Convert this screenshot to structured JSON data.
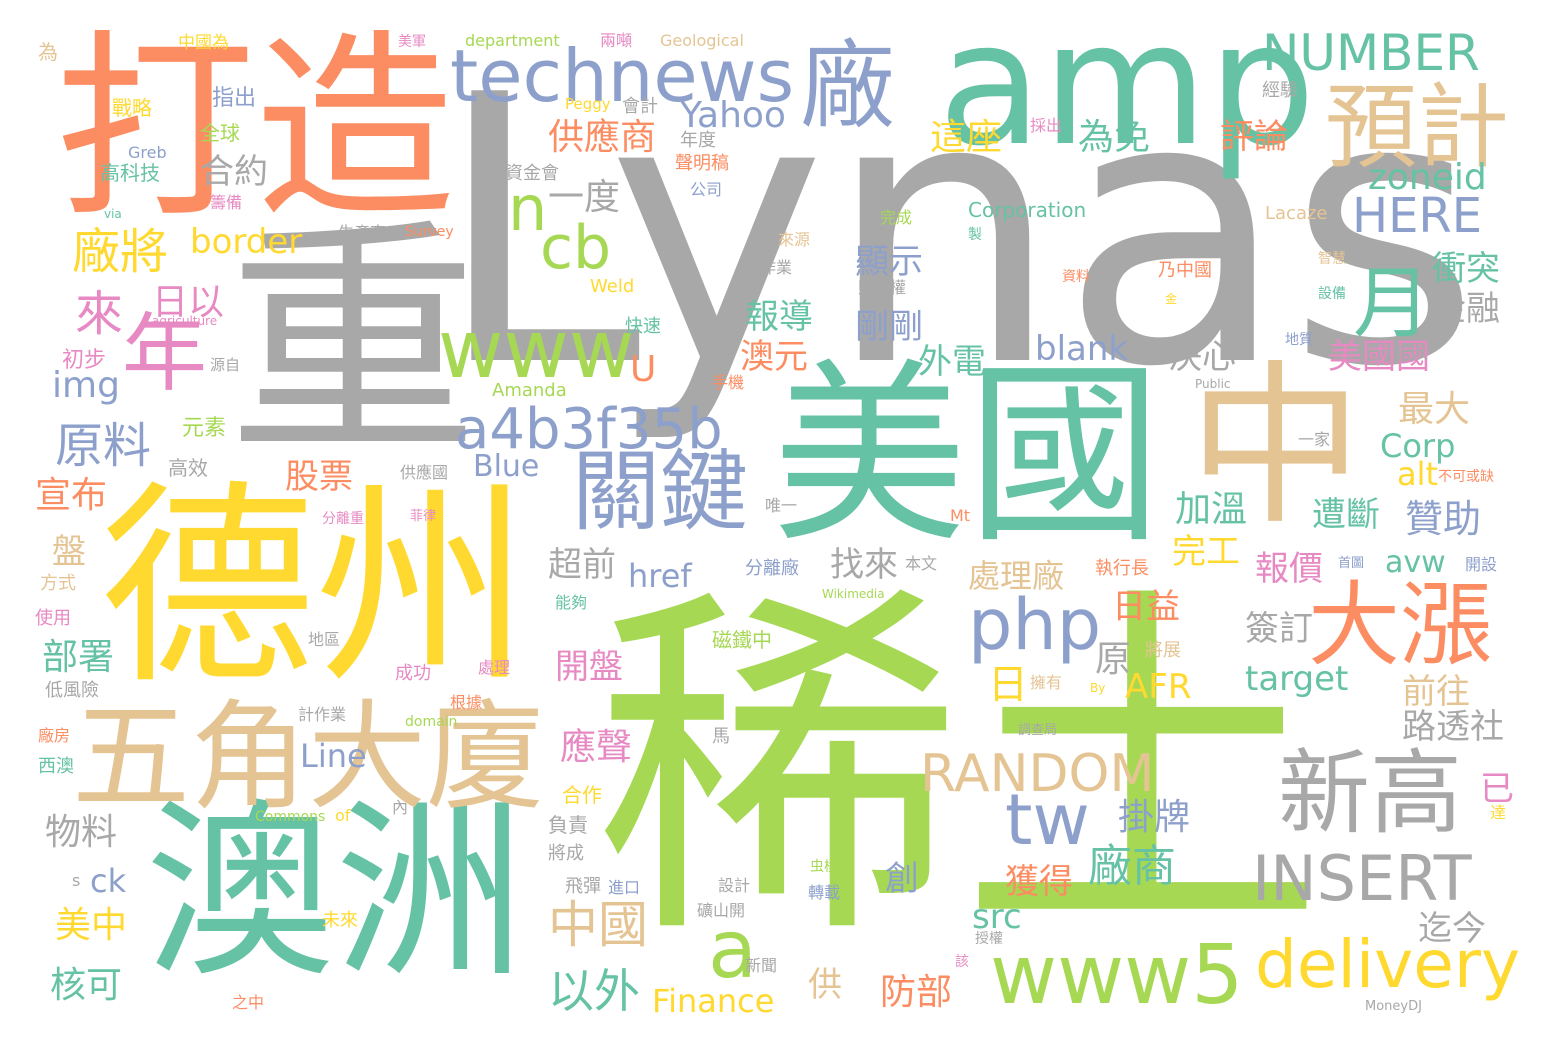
{
  "palette": {
    "gray": "#a8a8a8",
    "green": "#66c2a5",
    "orange": "#fc8d62",
    "blue": "#8da0cb",
    "pink": "#e78ac3",
    "lime": "#a6d854",
    "yellow": "#ffd92f",
    "tan": "#e5c494"
  },
  "words": [
    {
      "text": "Lynas",
      "color": "gray"
    },
    {
      "text": "稀土",
      "color": "lime"
    },
    {
      "text": "重",
      "color": "gray"
    },
    {
      "text": "美國",
      "color": "green"
    },
    {
      "text": "德州",
      "color": "yellow"
    },
    {
      "text": "澳洲",
      "color": "green"
    },
    {
      "text": "打造",
      "color": "orange"
    },
    {
      "text": "amp",
      "color": "green"
    },
    {
      "text": "中",
      "color": "tan"
    },
    {
      "text": "五角大廈",
      "color": "tan"
    },
    {
      "text": "technews",
      "color": "blue"
    },
    {
      "text": "廠",
      "color": "blue"
    },
    {
      "text": "NUMBER",
      "color": "green"
    },
    {
      "text": "預計",
      "color": "tan"
    },
    {
      "text": "月",
      "color": "green"
    },
    {
      "text": "年",
      "color": "pink"
    },
    {
      "text": "www",
      "color": "lime"
    },
    {
      "text": "關鍵",
      "color": "blue"
    },
    {
      "text": "a4b3f35b",
      "color": "blue"
    },
    {
      "text": "cb",
      "color": "lime"
    },
    {
      "text": "n",
      "color": "lime"
    },
    {
      "text": "www5",
      "color": "lime"
    },
    {
      "text": "delivery",
      "color": "yellow"
    },
    {
      "text": "大漲",
      "color": "orange"
    },
    {
      "text": "新高",
      "color": "gray"
    },
    {
      "text": "INSERT",
      "color": "gray"
    },
    {
      "text": "php",
      "color": "blue"
    },
    {
      "text": "tw",
      "color": "blue"
    },
    {
      "text": "a",
      "color": "lime"
    },
    {
      "text": "RANDOM",
      "color": "tan"
    },
    {
      "text": "HERE",
      "color": "blue"
    },
    {
      "text": "zoneid",
      "color": "green"
    },
    {
      "text": "廠將",
      "color": "yellow"
    },
    {
      "text": "來",
      "color": "pink"
    },
    {
      "text": "原料",
      "color": "blue"
    },
    {
      "text": "border",
      "color": "yellow"
    },
    {
      "text": "合約",
      "color": "gray"
    },
    {
      "text": "供應商",
      "color": "orange"
    },
    {
      "text": "Yahoo",
      "color": "blue"
    },
    {
      "text": "一度",
      "color": "gray"
    },
    {
      "text": "這座",
      "color": "yellow"
    },
    {
      "text": "為免",
      "color": "green"
    },
    {
      "text": "評論",
      "color": "orange"
    },
    {
      "text": "日以",
      "color": "pink"
    },
    {
      "text": "img",
      "color": "blue"
    },
    {
      "text": "宣布",
      "color": "orange"
    },
    {
      "text": "股票",
      "color": "orange"
    },
    {
      "text": "報導",
      "color": "green"
    },
    {
      "text": "剛剛",
      "color": "blue"
    },
    {
      "text": "顯示",
      "color": "blue"
    },
    {
      "text": "澳元",
      "color": "orange"
    },
    {
      "text": "外電",
      "color": "green"
    },
    {
      "text": "blank",
      "color": "blue"
    },
    {
      "text": "決心",
      "color": "gray"
    },
    {
      "text": "美國國",
      "color": "pink"
    },
    {
      "text": "最大",
      "color": "tan"
    },
    {
      "text": "衝突",
      "color": "green"
    },
    {
      "text": "金融",
      "color": "gray"
    },
    {
      "text": "U",
      "color": "orange"
    },
    {
      "text": "Blue",
      "color": "blue"
    },
    {
      "text": "Corp",
      "color": "green"
    },
    {
      "text": "alt",
      "color": "yellow"
    },
    {
      "text": "加溫",
      "color": "green"
    },
    {
      "text": "贊助",
      "color": "blue"
    },
    {
      "text": "遭斷",
      "color": "green"
    },
    {
      "text": "完工",
      "color": "yellow"
    },
    {
      "text": "報價",
      "color": "pink"
    },
    {
      "text": "avw",
      "color": "green"
    },
    {
      "text": "超前",
      "color": "gray"
    },
    {
      "text": "找來",
      "color": "gray"
    },
    {
      "text": "href",
      "color": "blue"
    },
    {
      "text": "處理廠",
      "color": "tan"
    },
    {
      "text": "日益",
      "color": "orange"
    },
    {
      "text": "部署",
      "color": "green"
    },
    {
      "text": "開盤",
      "color": "pink"
    },
    {
      "text": "日",
      "color": "yellow"
    },
    {
      "text": "原",
      "color": "gray"
    },
    {
      "text": "AFR",
      "color": "yellow"
    },
    {
      "text": "簽訂",
      "color": "gray"
    },
    {
      "text": "target",
      "color": "green"
    },
    {
      "text": "前往",
      "color": "tan"
    },
    {
      "text": "路透社",
      "color": "gray"
    },
    {
      "text": "Line",
      "color": "blue"
    },
    {
      "text": "應聲",
      "color": "pink"
    },
    {
      "text": "物料",
      "color": "gray"
    },
    {
      "text": "掛牌",
      "color": "blue"
    },
    {
      "text": "廠商",
      "color": "green"
    },
    {
      "text": "獲得",
      "color": "orange"
    },
    {
      "text": "ck",
      "color": "blue"
    },
    {
      "text": "美中",
      "color": "yellow"
    },
    {
      "text": "中國",
      "color": "tan"
    },
    {
      "text": "以外",
      "color": "green"
    },
    {
      "text": "src",
      "color": "green"
    },
    {
      "text": "創",
      "color": "blue"
    },
    {
      "text": "迄今",
      "color": "gray"
    },
    {
      "text": "已",
      "color": "pink"
    },
    {
      "text": "核可",
      "color": "green"
    },
    {
      "text": "Finance",
      "color": "yellow"
    },
    {
      "text": "供",
      "color": "tan"
    },
    {
      "text": "防部",
      "color": "orange"
    },
    {
      "text": "盤",
      "color": "tan"
    },
    {
      "text": "元素",
      "color": "lime"
    },
    {
      "text": "高效",
      "color": "gray"
    },
    {
      "text": "初步",
      "color": "pink"
    },
    {
      "text": "全球",
      "color": "lime"
    },
    {
      "text": "指出",
      "color": "blue"
    },
    {
      "text": "戰略",
      "color": "yellow"
    },
    {
      "text": "高科技",
      "color": "green"
    },
    {
      "text": "中國為",
      "color": "yellow"
    },
    {
      "text": "美軍",
      "color": "pink"
    },
    {
      "text": "department",
      "color": "lime"
    },
    {
      "text": "兩噸",
      "color": "pink"
    },
    {
      "text": "Geological",
      "color": "tan"
    },
    {
      "text": "為",
      "color": "tan"
    },
    {
      "text": "Greb",
      "color": "blue"
    },
    {
      "text": "via",
      "color": "green"
    },
    {
      "text": "agriculture",
      "color": "pink"
    },
    {
      "text": "籌備",
      "color": "pink"
    },
    {
      "text": "資金會",
      "color": "gray"
    },
    {
      "text": "會計",
      "color": "gray"
    },
    {
      "text": "年度",
      "color": "gray"
    },
    {
      "text": "Peggy",
      "color": "yellow"
    },
    {
      "text": "聲明稿",
      "color": "orange"
    },
    {
      "text": "公司",
      "color": "blue"
    },
    {
      "text": "經驗",
      "color": "gray"
    },
    {
      "text": "採出",
      "color": "pink"
    },
    {
      "text": "完成",
      "color": "lime"
    },
    {
      "text": "Corporation",
      "color": "green"
    },
    {
      "text": "Lacaze",
      "color": "tan"
    },
    {
      "text": "生產商",
      "color": "gray"
    },
    {
      "text": "Survey",
      "color": "orange"
    },
    {
      "text": "製",
      "color": "green"
    },
    {
      "text": "來源",
      "color": "tan"
    },
    {
      "text": "智慧",
      "color": "tan"
    },
    {
      "text": "作業",
      "color": "gray"
    },
    {
      "text": "Weld",
      "color": "yellow"
    },
    {
      "text": "財產權",
      "color": "gray"
    },
    {
      "text": "資料",
      "color": "orange"
    },
    {
      "text": "乃中國",
      "color": "orange"
    },
    {
      "text": "金",
      "color": "yellow"
    },
    {
      "text": "設備",
      "color": "green"
    },
    {
      "text": "快速",
      "color": "green"
    },
    {
      "text": "地質",
      "color": "blue"
    },
    {
      "text": "能以",
      "color": "gray"
    },
    {
      "text": "Public",
      "color": "gray"
    },
    {
      "text": "源自",
      "color": "gray"
    },
    {
      "text": "手機",
      "color": "orange"
    },
    {
      "text": "Amanda",
      "color": "lime"
    },
    {
      "text": "一家",
      "color": "gray"
    },
    {
      "text": "不可或缺",
      "color": "orange"
    },
    {
      "text": "供應國",
      "color": "gray"
    },
    {
      "text": "分離重",
      "color": "pink"
    },
    {
      "text": "菲律",
      "color": "pink"
    },
    {
      "text": "唯一",
      "color": "gray"
    },
    {
      "text": "Mt",
      "color": "orange"
    },
    {
      "text": "分離廠",
      "color": "blue"
    },
    {
      "text": "本文",
      "color": "gray"
    },
    {
      "text": "執行長",
      "color": "orange"
    },
    {
      "text": "首圖",
      "color": "blue"
    },
    {
      "text": "開設",
      "color": "blue"
    },
    {
      "text": "Wikimedia",
      "color": "lime"
    },
    {
      "text": "方式",
      "color": "tan"
    },
    {
      "text": "使用",
      "color": "pink"
    },
    {
      "text": "能夠",
      "color": "green"
    },
    {
      "text": "地區",
      "color": "gray"
    },
    {
      "text": "磁鐵中",
      "color": "lime"
    },
    {
      "text": "將展",
      "color": "tan"
    },
    {
      "text": "低風險",
      "color": "gray"
    },
    {
      "text": "成功",
      "color": "pink"
    },
    {
      "text": "處理",
      "color": "pink"
    },
    {
      "text": "擁有",
      "color": "tan"
    },
    {
      "text": "By",
      "color": "yellow"
    },
    {
      "text": "根據",
      "color": "orange"
    },
    {
      "text": "計作業",
      "color": "gray"
    },
    {
      "text": "domain",
      "color": "lime"
    },
    {
      "text": "馬",
      "color": "gray"
    },
    {
      "text": "調查局",
      "color": "gray"
    },
    {
      "text": "廠房",
      "color": "orange"
    },
    {
      "text": "西澳",
      "color": "green"
    },
    {
      "text": "Commons",
      "color": "lime"
    },
    {
      "text": "of",
      "color": "yellow"
    },
    {
      "text": "內",
      "color": "gray"
    },
    {
      "text": "合作",
      "color": "yellow"
    },
    {
      "text": "負責",
      "color": "gray"
    },
    {
      "text": "達",
      "color": "yellow"
    },
    {
      "text": "將成",
      "color": "gray"
    },
    {
      "text": "s",
      "color": "gray"
    },
    {
      "text": "飛彈",
      "color": "gray"
    },
    {
      "text": "進口",
      "color": "blue"
    },
    {
      "text": "設計",
      "color": "gray"
    },
    {
      "text": "虫棱",
      "color": "lime"
    },
    {
      "text": "轉載",
      "color": "blue"
    },
    {
      "text": "礦山開",
      "color": "gray"
    },
    {
      "text": "未來",
      "color": "yellow"
    },
    {
      "text": "授權",
      "color": "gray"
    },
    {
      "text": "該",
      "color": "pink"
    },
    {
      "text": "新聞",
      "color": "gray"
    },
    {
      "text": "之中",
      "color": "orange"
    },
    {
      "text": "MoneyDJ",
      "color": "gray"
    }
  ]
}
